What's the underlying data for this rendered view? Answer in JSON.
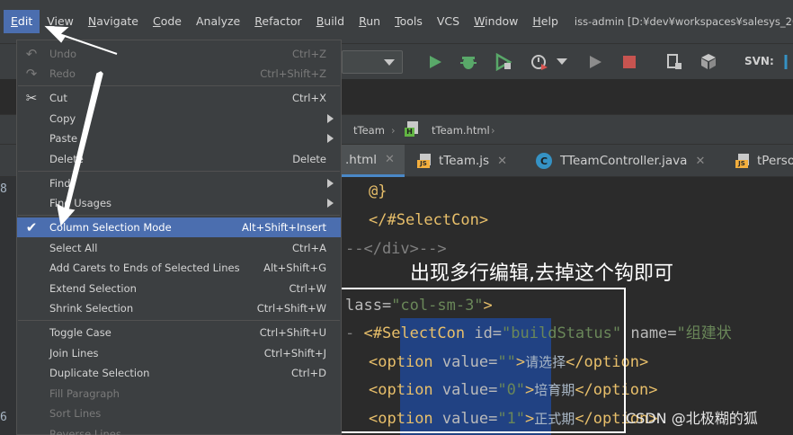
{
  "menubar": {
    "items": [
      {
        "label": "Edit",
        "m": "E",
        "rest": "dit"
      },
      {
        "label": "View",
        "m": "V",
        "rest": "iew"
      },
      {
        "label": "Navigate",
        "m": "N",
        "rest": "avigate"
      },
      {
        "label": "Code",
        "m": "C",
        "rest": "ode"
      },
      {
        "label": "Analyze",
        "m": "",
        "rest": "Analyze"
      },
      {
        "label": "Refactor",
        "m": "R",
        "rest": "efactor"
      },
      {
        "label": "Build",
        "m": "B",
        "rest": "uild"
      },
      {
        "label": "Run",
        "m": "R",
        "rest": "un"
      },
      {
        "label": "Tools",
        "m": "T",
        "rest": "ools"
      },
      {
        "label": "VCS",
        "m": "",
        "rest": "VCS"
      },
      {
        "label": "Window",
        "m": "W",
        "rest": "indow"
      },
      {
        "label": "Help",
        "m": "H",
        "rest": "elp"
      }
    ],
    "window_title": "iss-admin [D:¥dev¥workspaces¥salesys_20211"
  },
  "toolbar": {
    "svn_label": "SVN:"
  },
  "breadcrumb": {
    "item1": "tTeam",
    "item2": "tTeam.html"
  },
  "tabs": [
    {
      "label": ".html",
      "icon": "html-file-icon"
    },
    {
      "label": "tTeam.js",
      "icon": "js-file-icon"
    },
    {
      "label": "TTeamController.java",
      "icon": "java-class-icon"
    },
    {
      "label": "tPerso",
      "icon": "js-file-icon"
    }
  ],
  "gutter": {
    "lines": [
      "8",
      "",
      "",
      "",
      "",
      "",
      "",
      "",
      "6"
    ]
  },
  "edit_menu": {
    "undo": {
      "label": "Undo",
      "shortcut": "Ctrl+Z"
    },
    "redo": {
      "label": "Redo",
      "shortcut": "Ctrl+Shift+Z"
    },
    "cut": {
      "label": "Cut",
      "shortcut": "Ctrl+X"
    },
    "copy": {
      "label": "Copy"
    },
    "paste": {
      "label": "Paste"
    },
    "delete": {
      "label": "Delete",
      "shortcut": "Delete"
    },
    "find": {
      "label": "Find"
    },
    "find_usages": {
      "label": "Find Usages"
    },
    "column_selection": {
      "label": "Column Selection Mode",
      "shortcut": "Alt+Shift+Insert",
      "checked": true
    },
    "select_all": {
      "label": "Select All",
      "shortcut": "Ctrl+A"
    },
    "add_carets": {
      "label": "Add Carets to Ends of Selected Lines",
      "shortcut": "Alt+Shift+G"
    },
    "extend_selection": {
      "label": "Extend Selection",
      "shortcut": "Ctrl+W"
    },
    "shrink_selection": {
      "label": "Shrink Selection",
      "shortcut": "Ctrl+Shift+W"
    },
    "toggle_case": {
      "label": "Toggle Case",
      "shortcut": "Ctrl+Shift+U"
    },
    "join_lines": {
      "label": "Join Lines",
      "shortcut": "Ctrl+Shift+J"
    },
    "duplicate_selection": {
      "label": "Duplicate Selection",
      "shortcut": "Ctrl+D"
    },
    "fill_paragraph": {
      "label": "Fill Paragraph"
    },
    "sort_lines": {
      "label": "Sort Lines"
    },
    "reverse_lines": {
      "label": "Reverse Lines"
    }
  },
  "code": {
    "line1": {
      "text": "@}"
    },
    "line2": {
      "open": "</",
      "name": "#SelectCon",
      "close": ">"
    },
    "line3": {
      "text": "--</div>-->"
    },
    "line4": {
      "attr": "lass=",
      "val": "\"col-sm-3\"",
      "close": ">"
    },
    "line5": {
      "dash": "- ",
      "open": "<",
      "name": "#SelectCon",
      "a1": " id=",
      "v1": "\"buildStatus\"",
      "a2": " name=",
      "v2": "\"组建状"
    },
    "line6": {
      "open": "<",
      "name": "option",
      "a": " value=",
      "v": "\"\"",
      "close": ">",
      "txt": "请选择",
      "end": "</option>"
    },
    "line7": {
      "open": "<",
      "name": "option",
      "a": " value=",
      "v": "\"0\"",
      "close": ">",
      "txt": "培育期",
      "end": "</option>"
    },
    "line8": {
      "open": "<",
      "name": "option",
      "a": " value=",
      "v": "\"1\"",
      "close": ">",
      "txt": "正式期",
      "end": "</option>"
    }
  },
  "annotation": {
    "text": "出现多行编辑,去掉这个钩即可"
  },
  "watermark": {
    "text": "CSDN @北极糊的狐"
  },
  "colors": {
    "accent": "#4b6eaf",
    "selection": "#214283",
    "tag": "#e8bf6a",
    "string": "#6a8759"
  }
}
